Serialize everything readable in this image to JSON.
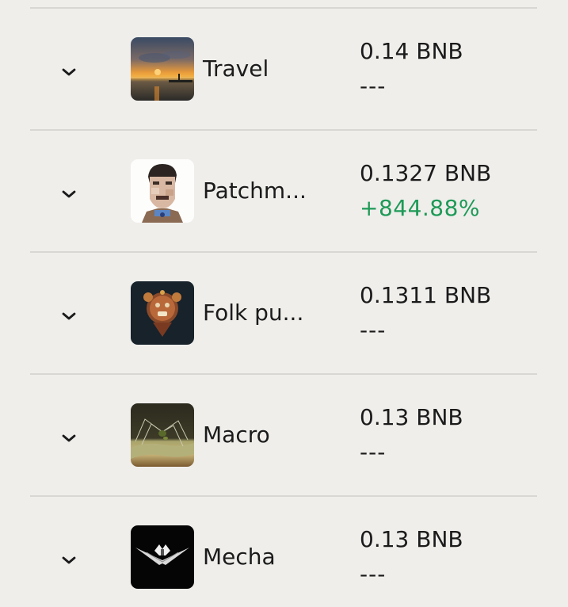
{
  "rows": [
    {
      "name": "Travel",
      "price": "0.14 BNB",
      "change": "---",
      "change_color": "#1b1b1b",
      "thumb_icon": "travel-sunset-thumbnail"
    },
    {
      "name": "Patchm...",
      "price": "0.1327 BNB",
      "change": "+844.88%",
      "change_color": "#1e9a57",
      "thumb_icon": "patchwork-portrait-thumbnail"
    },
    {
      "name": "Folk pu...",
      "price": "0.1311 BNB",
      "change": "---",
      "change_color": "#1b1b1b",
      "thumb_icon": "folk-puppet-mask-thumbnail"
    },
    {
      "name": "Macro",
      "price": "0.13 BNB",
      "change": "---",
      "change_color": "#1b1b1b",
      "thumb_icon": "macro-spider-thumbnail"
    },
    {
      "name": "Mecha",
      "price": "0.13 BNB",
      "change": "---",
      "change_color": "#1b1b1b",
      "thumb_icon": "mecha-ship-thumbnail"
    }
  ]
}
